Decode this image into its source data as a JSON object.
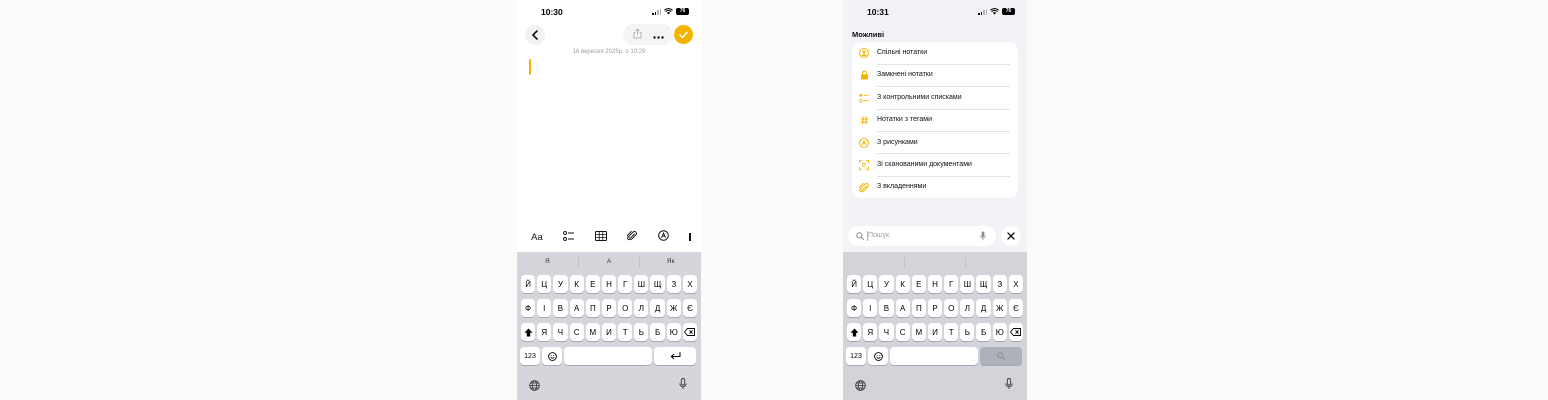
{
  "left_screen": {
    "status": {
      "time": "10:30",
      "battery": "76"
    },
    "note_date": "16 вересня 2025р. о 10:29",
    "toolbar": {
      "format_label": "Aa"
    },
    "predictions": [
      "Я",
      "А",
      "Як"
    ]
  },
  "right_screen": {
    "status": {
      "time": "10:31",
      "battery": "76"
    },
    "section_title": "Можливі",
    "suggestions": [
      {
        "label": "Спільні нотатки",
        "icon": "shared-person-icon"
      },
      {
        "label": "Замкнені нотатки",
        "icon": "lock-icon"
      },
      {
        "label": "З контрольними списками",
        "icon": "checklist-icon"
      },
      {
        "label": "Нотатки з тегами",
        "icon": "hashtag-icon"
      },
      {
        "label": "З рисунками",
        "icon": "drawing-icon"
      },
      {
        "label": "Зі сканованими документами",
        "icon": "scan-icon"
      },
      {
        "label": "З вкладеннями",
        "icon": "paperclip-icon"
      }
    ],
    "search": {
      "placeholder": "Пошук"
    }
  },
  "keyboard": {
    "row1": [
      "Й",
      "Ц",
      "У",
      "К",
      "Е",
      "Н",
      "Г",
      "Ш",
      "Щ",
      "З",
      "Х"
    ],
    "row2": [
      "Ф",
      "І",
      "В",
      "А",
      "П",
      "Р",
      "О",
      "Л",
      "Д",
      "Ж",
      "Є"
    ],
    "row3": [
      "Я",
      "Ч",
      "С",
      "М",
      "И",
      "Т",
      "Ь",
      "Б",
      "Ю"
    ],
    "numbers_label": "123"
  },
  "colors": {
    "accent": "#f3b400"
  }
}
